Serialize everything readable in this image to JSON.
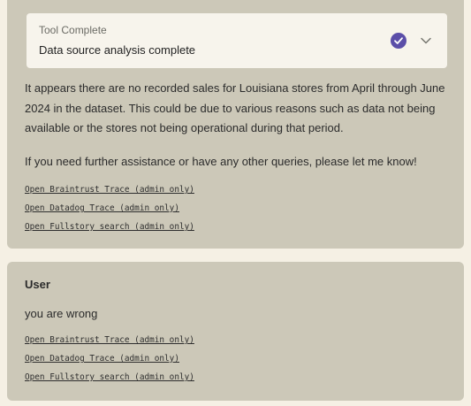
{
  "assistant": {
    "tool": {
      "title": "Tool Complete",
      "description": "Data source analysis complete",
      "status_icon": "check-circle-icon",
      "status_color": "#5b4ea8",
      "toggle_icon": "chevron-down-icon"
    },
    "paragraphs": [
      "It appears there are no recorded sales for Louisiana stores from April through June 2024 in the dataset. This could be due to various reasons such as data not being available or the stores not being operational during that period.",
      "If you need further assistance or have any other queries, please let me know!"
    ],
    "links": [
      "Open Braintrust Trace (admin only)",
      "Open Datadog Trace (admin only)",
      "Open Fullstory search (admin only)"
    ]
  },
  "user_message": {
    "label": "User",
    "text": "you are wrong",
    "links": [
      "Open Braintrust Trace (admin only)",
      "Open Datadog Trace (admin only)",
      "Open Fullstory search (admin only)"
    ]
  }
}
